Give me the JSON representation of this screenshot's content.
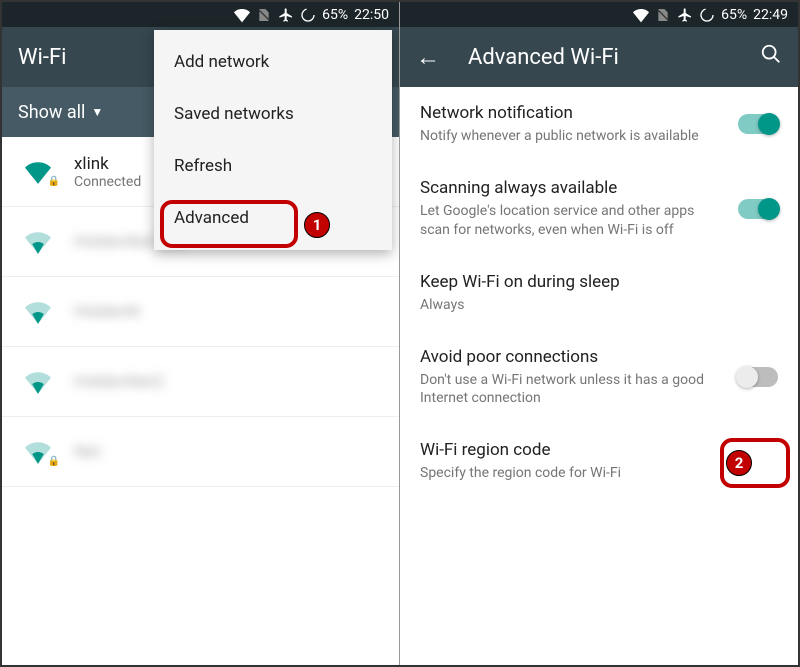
{
  "left": {
    "status": {
      "battery_pct": "65%",
      "time": "22:50"
    },
    "appbar": {
      "title": "Wi-Fi"
    },
    "filter": {
      "label": "Show all"
    },
    "networks": [
      {
        "name": "xlink",
        "status": "Connected",
        "secure": true,
        "strong": true
      },
      {
        "name": "HiddenNet One",
        "status": "",
        "secure": false,
        "strong": false,
        "blur": true
      },
      {
        "name": "HiddenN",
        "status": "",
        "secure": false,
        "strong": false,
        "blur": true
      },
      {
        "name": "HiddenNet2",
        "status": "",
        "secure": false,
        "strong": false,
        "blur": true
      },
      {
        "name": "Net",
        "status": "",
        "secure": true,
        "strong": false,
        "blur": true
      }
    ],
    "menu": {
      "items": [
        {
          "label": "Add network"
        },
        {
          "label": "Saved networks"
        },
        {
          "label": "Refresh"
        },
        {
          "label": "Advanced"
        }
      ]
    }
  },
  "right": {
    "status": {
      "battery_pct": "65%",
      "time": "22:49"
    },
    "appbar": {
      "title": "Advanced Wi-Fi"
    },
    "settings": [
      {
        "title": "Network notification",
        "sub": "Notify whenever a public network is available",
        "toggle": "on"
      },
      {
        "title": "Scanning always available",
        "sub": "Let Google's location service and other apps scan for networks, even when Wi-Fi is off",
        "toggle": "on"
      },
      {
        "title": "Keep Wi-Fi on during sleep",
        "sub": "Always",
        "toggle": null
      },
      {
        "title": "Avoid poor connections",
        "sub": "Don't use a Wi-Fi network unless it has a good Internet connection",
        "toggle": "off"
      },
      {
        "title": "Wi-Fi region code",
        "sub": "Specify the region code for Wi-Fi",
        "toggle": null
      }
    ]
  },
  "callouts": {
    "one": "1",
    "two": "2"
  }
}
